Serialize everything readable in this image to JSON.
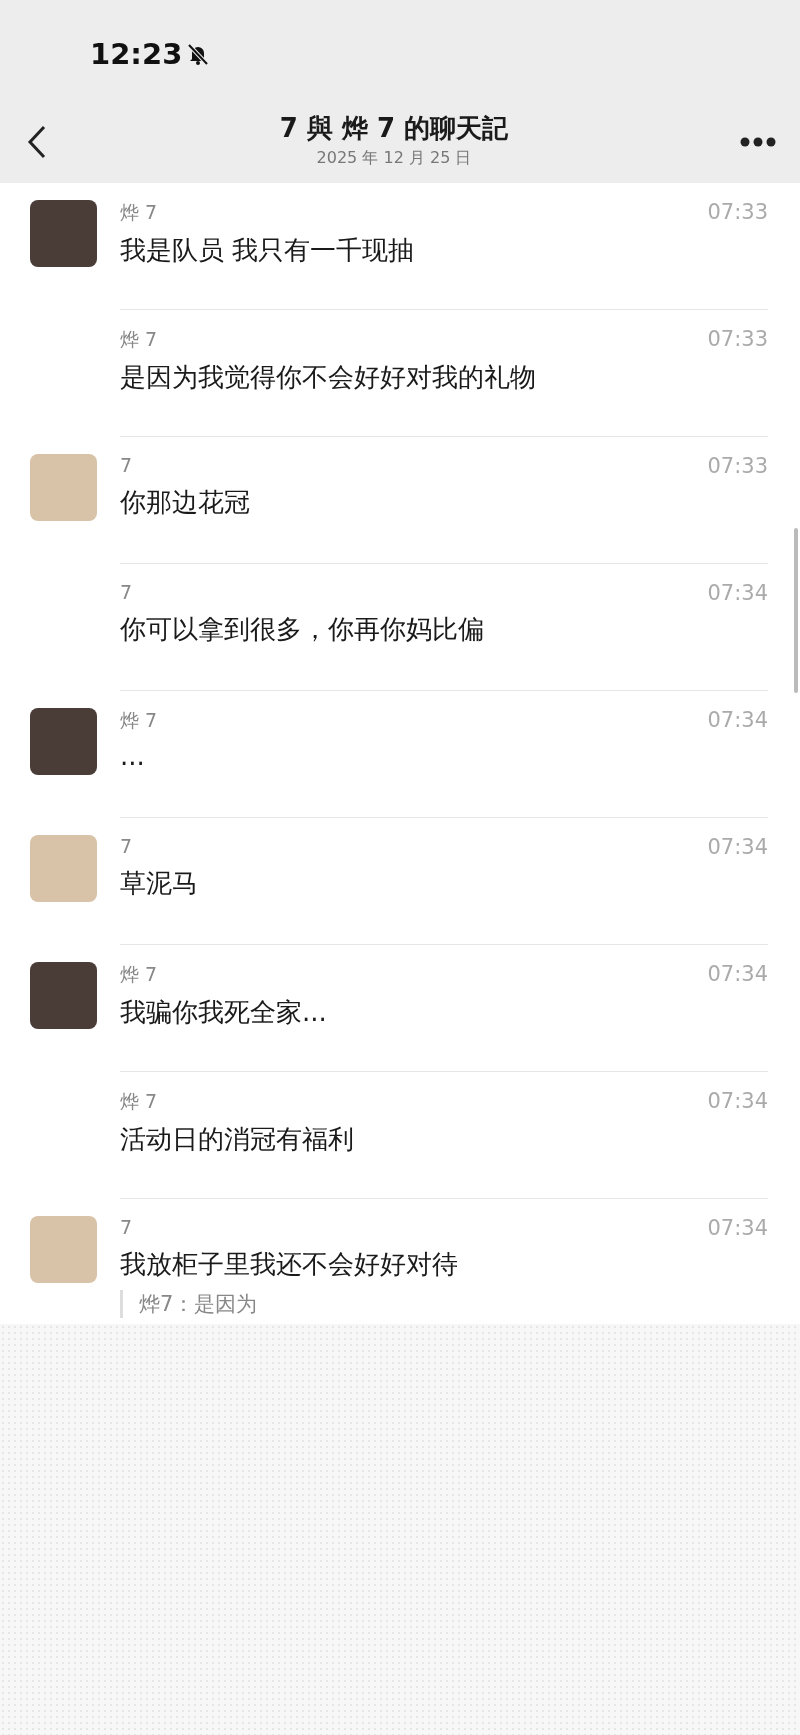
{
  "status_bar": {
    "time": "12:23",
    "muted": true
  },
  "header": {
    "title": "7 與 烨 7 的聊天記",
    "subtitle": "2025 年 12 月 25 日"
  },
  "messages": [
    {
      "sender": "烨 7",
      "time": "07:33",
      "text": "我是队员 我只有一千现抽",
      "avatar": true,
      "color": "#4a3c36"
    },
    {
      "sender": "烨 7",
      "time": "07:33",
      "text": "是因为我觉得你不会好好对我的礼物",
      "avatar": false
    },
    {
      "sender": "7",
      "time": "07:33",
      "text": "你那边花冠",
      "avatar": true,
      "color": "#d9c3a8"
    },
    {
      "sender": "7",
      "time": "07:34",
      "text": "你可以拿到很多，你再你妈比偏",
      "avatar": false
    },
    {
      "sender": "烨 7",
      "time": "07:34",
      "text": "...",
      "avatar": true,
      "color": "#4a3c36"
    },
    {
      "sender": "7",
      "time": "07:34",
      "text": "草泥马",
      "avatar": true,
      "color": "#d9c3a8"
    },
    {
      "sender": "烨 7",
      "time": "07:34",
      "text": "我骗你我死全家...",
      "avatar": true,
      "color": "#4a3c36"
    },
    {
      "sender": "烨 7",
      "time": "07:34",
      "text": "活动日的消冠有福利",
      "avatar": false
    },
    {
      "sender": "7",
      "time": "07:34",
      "text": "我放柜子里我还不会好好对待",
      "avatar": true,
      "color": "#d9c3a8",
      "quote": "烨7：是因为"
    }
  ]
}
